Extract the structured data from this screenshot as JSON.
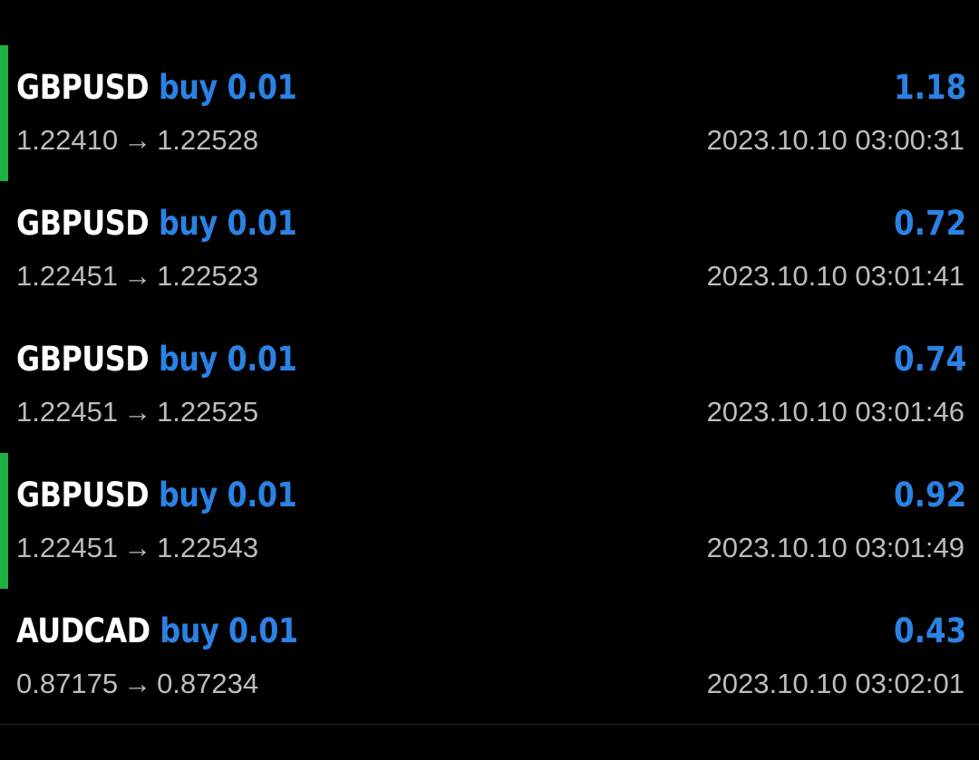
{
  "colors": {
    "background": "#000000",
    "symbol_text": "#ffffff",
    "accent_blue": "#2b82e4",
    "secondary_text": "#bdbdbd",
    "indicator_green": "#1fb141"
  },
  "arrow_glyph": "→",
  "trades": [
    {
      "symbol": "GBPUSD",
      "side": "buy",
      "volume": "0.01",
      "profit": "1.18",
      "open_price": "1.22410",
      "close_price": "1.22528",
      "time": "2023.10.10 03:00:31",
      "highlighted": true
    },
    {
      "symbol": "GBPUSD",
      "side": "buy",
      "volume": "0.01",
      "profit": "0.72",
      "open_price": "1.22451",
      "close_price": "1.22523",
      "time": "2023.10.10 03:01:41",
      "highlighted": false
    },
    {
      "symbol": "GBPUSD",
      "side": "buy",
      "volume": "0.01",
      "profit": "0.74",
      "open_price": "1.22451",
      "close_price": "1.22525",
      "time": "2023.10.10 03:01:46",
      "highlighted": false
    },
    {
      "symbol": "GBPUSD",
      "side": "buy",
      "volume": "0.01",
      "profit": "0.92",
      "open_price": "1.22451",
      "close_price": "1.22543",
      "time": "2023.10.10 03:01:49",
      "highlighted": true
    },
    {
      "symbol": "AUDCAD",
      "side": "buy",
      "volume": "0.01",
      "profit": "0.43",
      "open_price": "0.87175",
      "close_price": "0.87234",
      "time": "2023.10.10 03:02:01",
      "highlighted": false
    }
  ]
}
